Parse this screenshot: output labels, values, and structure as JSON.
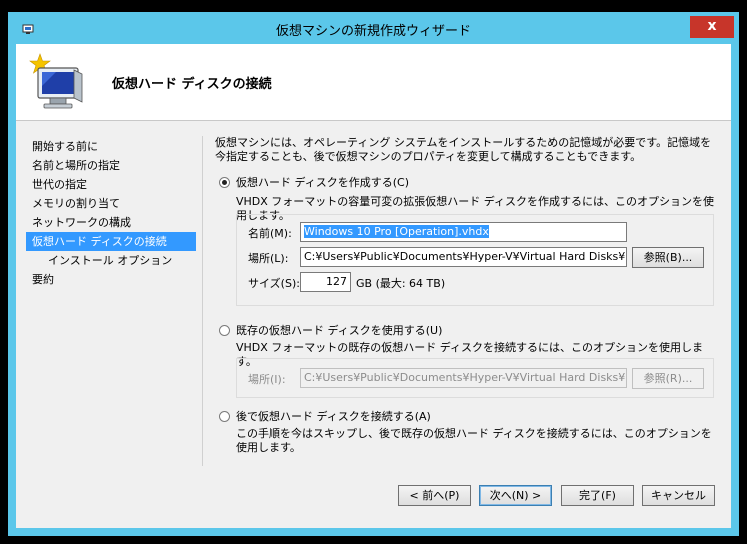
{
  "window": {
    "title": "仮想マシンの新規作成ウィザード",
    "close_glyph": "x"
  },
  "header": {
    "title": "仮想ハード ディスクの接続"
  },
  "nav": {
    "items": [
      {
        "label": "開始する前に"
      },
      {
        "label": "名前と場所の指定"
      },
      {
        "label": "世代の指定"
      },
      {
        "label": "メモリの割り当て"
      },
      {
        "label": "ネットワークの構成"
      },
      {
        "label": "仮想ハード ディスクの接続",
        "active": true
      },
      {
        "label": "インストール オプション",
        "sub": true
      },
      {
        "label": "要約"
      }
    ]
  },
  "intro": "仮想マシンには、オペレーティング システムをインストールするための記憶域が必要です。記憶域を今指定することも、後で仮想マシンのプロパティを変更して構成することもできます。",
  "option_create": {
    "label": "仮想ハード ディスクを作成する(C)",
    "selected": true,
    "desc": "VHDX フォーマットの容量可変の拡張仮想ハード ディスクを作成するには、このオプションを使用します。",
    "name_label": "名前(M):",
    "name_value": "Windows 10 Pro [Operation].vhdx",
    "location_label": "場所(L):",
    "location_value": "C:¥Users¥Public¥Documents¥Hyper-V¥Virtual Hard Disks¥",
    "browse_label": "参照(B)...",
    "size_label": "サイズ(S):",
    "size_value": "127",
    "size_unit": "GB (最大: 64 TB)"
  },
  "option_existing": {
    "label": "既存の仮想ハード ディスクを使用する(U)",
    "selected": false,
    "desc": "VHDX フォーマットの既存の仮想ハード ディスクを接続するには、このオプションを使用します。",
    "location_label": "場所(I):",
    "location_value": "C:¥Users¥Public¥Documents¥Hyper-V¥Virtual Hard Disks¥",
    "browse_label": "参照(R)..."
  },
  "option_later": {
    "label": "後で仮想ハード ディスクを接続する(A)",
    "selected": false,
    "desc": "この手順を今はスキップし、後で既存の仮想ハード ディスクを接続するには、このオプションを使用します。"
  },
  "footer": {
    "prev": "< 前へ(P)",
    "next": "次へ(N) >",
    "finish": "完了(F)",
    "cancel": "キャンセル"
  },
  "colors": {
    "accent": "#3399ff",
    "titlebar": "#5bc7ea",
    "close": "#c7352a"
  }
}
